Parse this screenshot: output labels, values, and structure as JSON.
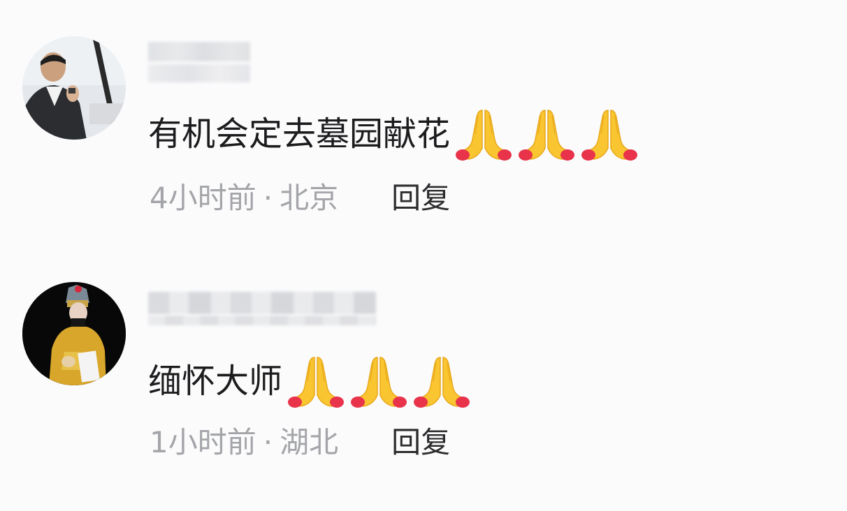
{
  "comments": [
    {
      "text": "有机会定去墓园献花",
      "emoji": "pray-icon",
      "emoji_count": 3,
      "time": "4小时前",
      "separator": "·",
      "location": "北京",
      "reply_label": "回复"
    },
    {
      "text": "缅怀大师",
      "emoji": "pray-icon",
      "emoji_count": 3,
      "time": "1小时前",
      "separator": "·",
      "location": "湖北",
      "reply_label": "回复"
    }
  ],
  "colors": {
    "background": "#fbfbfc",
    "text": "#1c1c1e",
    "meta": "#a4a5a9",
    "reply": "#2c2c2e",
    "emoji_yellow": "#f9c531",
    "emoji_red": "#e8334a"
  }
}
